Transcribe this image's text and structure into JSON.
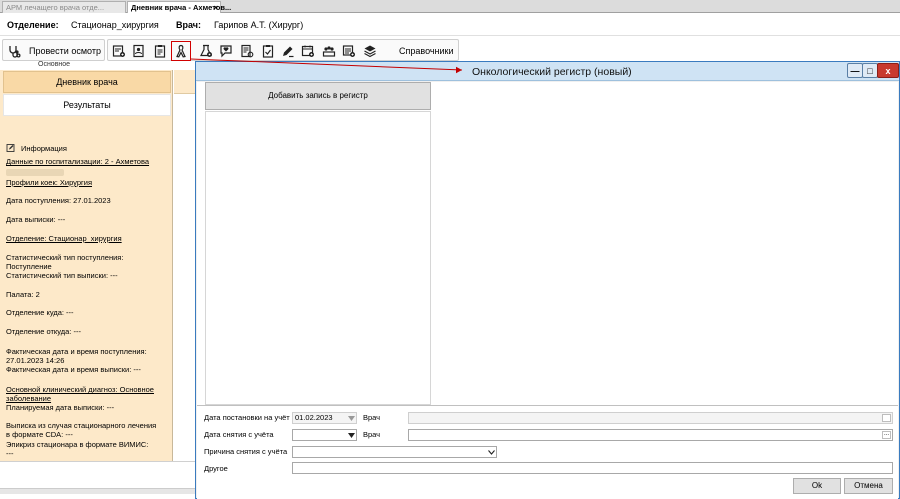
{
  "tabs": [
    {
      "label": "АРМ лечащего врача отде..."
    },
    {
      "label": "Дневник врача - Ахметов...",
      "close": "×"
    }
  ],
  "header": {
    "dept_label": "Отделение:",
    "dept_value": "Стационар_хирургия",
    "doctor_label": "Врач:",
    "doctor_value": "Гарипов А.Т. (Хирург)"
  },
  "toolbar": {
    "exam_button": "Провести осмотр",
    "references_button": "Справочники",
    "caption": "Основное"
  },
  "left_panel": {
    "tab_diary": "Дневник врача",
    "tab_results": "Результаты",
    "info_title": "Информация",
    "lines": [
      {
        "text": "Данные по госпитализации: 2 - Ахметова",
        "underline": true
      },
      {
        "text": "Профили коек: Хирургия",
        "underline": true
      },
      {
        "text": "Дата поступления: 27.01.2023",
        "underline": false
      },
      {
        "text": "Дата выписки: ---",
        "underline": false
      },
      {
        "text": "Отделение: Стационар_хирургия",
        "underline": true
      },
      {
        "text": "Статистический тип поступления:",
        "underline": false
      },
      {
        "text": "Поступление",
        "underline": false
      },
      {
        "text": "Статистический тип выписки: ---",
        "underline": false
      },
      {
        "text": "Палата: 2",
        "underline": false
      },
      {
        "text": "Отделение куда: ---",
        "underline": false
      },
      {
        "text": "Отделение откуда: ---",
        "underline": false
      },
      {
        "text": "Фактическая дата и время поступления:",
        "underline": false
      },
      {
        "text": "27.01.2023 14:26",
        "underline": false
      },
      {
        "text": "Фактическая дата и время выписки: ---",
        "underline": false
      },
      {
        "text": "Основной клинический диагноз: Основное",
        "underline": true
      },
      {
        "text": "заболевание",
        "underline": true
      },
      {
        "text": "Планируемая дата выписки: ---",
        "underline": false
      },
      {
        "text": "Выписка из случая стационарного лечения",
        "underline": false
      },
      {
        "text": "в формате CDA: ---",
        "underline": false
      },
      {
        "text": "Эпикриз стационара в формате ВИМИС:",
        "underline": false
      },
      {
        "text": "---",
        "underline": false
      }
    ]
  },
  "dialog": {
    "title": "Онкологический регистр (новый)",
    "add_record_button": "Добавить запись в регистр",
    "registration_date_label": "Дата постановки на учёт",
    "registration_date_value": "01.02.2023",
    "doctor_label_1": "Врач",
    "deregistration_date_label": "Дата снятия с учёта",
    "doctor_label_2": "Врач",
    "reason_label": "Причина снятия с учёта",
    "other_label": "Другое",
    "ok_button": "Ok",
    "cancel_button": "Отмена",
    "minimize_symbol": "—",
    "maximize_symbol": "□",
    "close_symbol": "x"
  },
  "colors": {
    "panel_bg": "#fde9c9",
    "active_tab": "#f9d9a6",
    "highlight": "#d10000",
    "title_bar": "#cfe3f4",
    "close_button": "#c8392e"
  }
}
